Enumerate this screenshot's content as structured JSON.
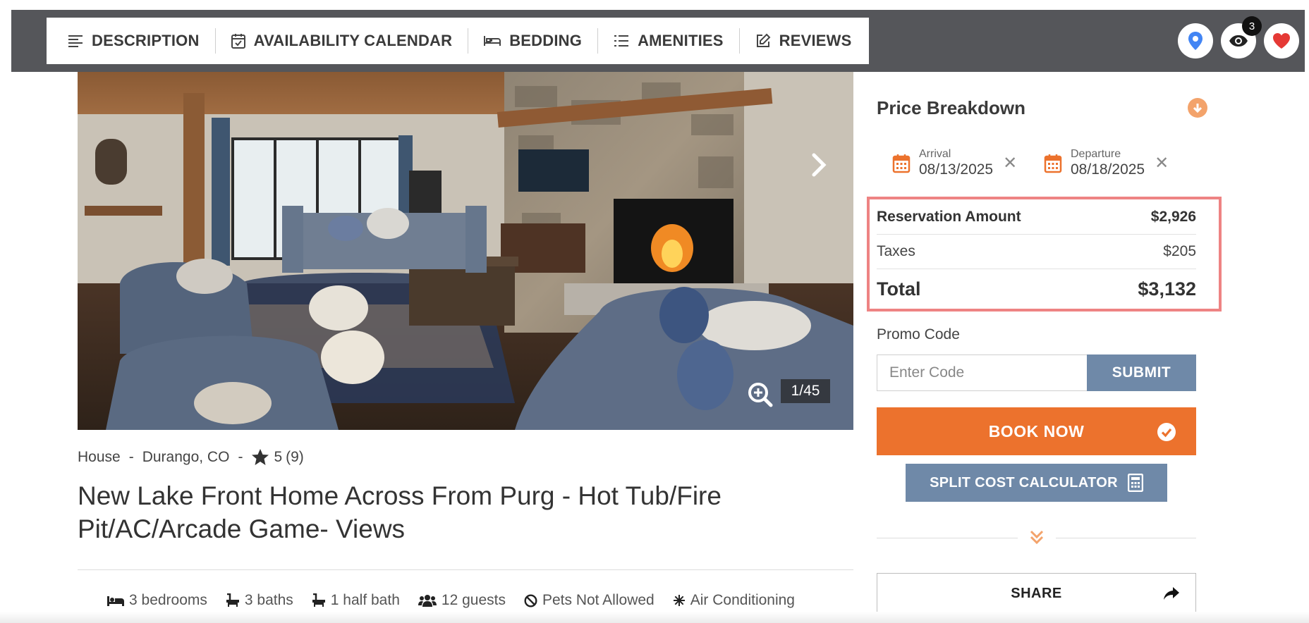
{
  "nav": {
    "tabs": [
      {
        "label": "DESCRIPTION",
        "icon": "description-lines-icon"
      },
      {
        "label": "AVAILABILITY CALENDAR",
        "icon": "calendar-check-icon"
      },
      {
        "label": "BEDDING",
        "icon": "bed-icon"
      },
      {
        "label": "AMENITIES",
        "icon": "list-icon"
      },
      {
        "label": "REVIEWS",
        "icon": "edit-icon"
      }
    ],
    "viewed_count": "3",
    "accent_map": "#4285f4",
    "accent_heart": "#e53935"
  },
  "gallery": {
    "counter": "1/45"
  },
  "listing": {
    "type": "House",
    "location": "Durango, CO",
    "rating": "5",
    "review_count": "(9)",
    "title": "New Lake Front Home Across From Purg - Hot Tub/Fire Pit/AC/Arcade Game- Views",
    "features": [
      {
        "label": "3 bedrooms",
        "icon": "bed-icon"
      },
      {
        "label": "3 baths",
        "icon": "bath-icon"
      },
      {
        "label": "1 half bath",
        "icon": "bath-icon"
      },
      {
        "label": "12 guests",
        "icon": "users-icon"
      },
      {
        "label": "Pets Not Allowed",
        "icon": "ban-icon"
      },
      {
        "label": "Air Conditioning",
        "icon": "snowflake-icon"
      }
    ]
  },
  "pricing": {
    "title": "Price Breakdown",
    "arrival": {
      "label": "Arrival",
      "value": "08/13/2025"
    },
    "departure": {
      "label": "Departure",
      "value": "08/18/2025"
    },
    "reservation_label": "Reservation Amount",
    "reservation_value": "$2,926",
    "taxes_label": "Taxes",
    "taxes_value": "$205",
    "total_label": "Total",
    "total_value": "$3,132",
    "promo_label": "Promo Code",
    "promo_placeholder": "Enter Code",
    "submit_label": "SUBMIT",
    "book_label": "BOOK NOW",
    "split_label": "SPLIT COST CALCULATOR",
    "share_label": "SHARE",
    "accent_orange": "#ec722d",
    "accent_slate": "#6f89a8",
    "highlight_color": "#ee8383"
  }
}
